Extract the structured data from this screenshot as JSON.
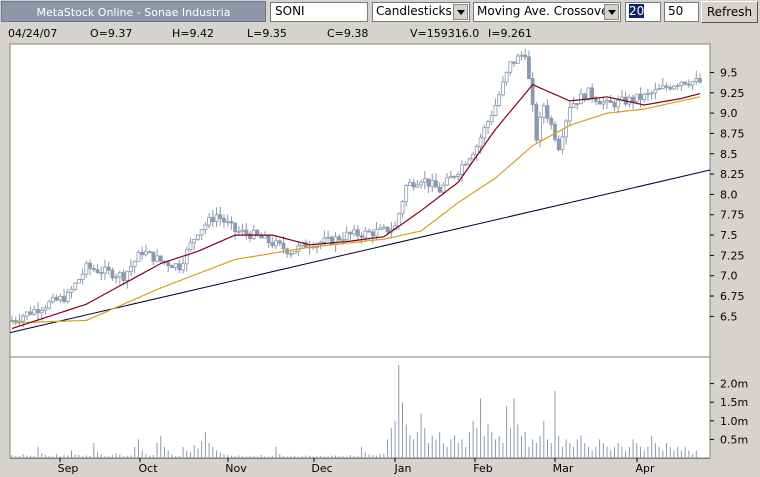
{
  "toolbar": {
    "title": "MetaStock Online - Sonae Industria",
    "symbol": "SONI",
    "chart_type": "Candlesticks",
    "indicator": "Moving Ave. Crossover",
    "period1": "20",
    "period2": "50",
    "refresh_label": "Refresh"
  },
  "quote": {
    "date": "04/24/07",
    "open": "O=9.37",
    "high": "H=9.42",
    "low": "L=9.35",
    "close": "C=9.38",
    "volume": "V=159316.0",
    "indicator": "I=9.261"
  },
  "colors": {
    "background": "#d6d3ce",
    "plot": "#ffffff",
    "candle": "#8a9ab0",
    "ma_short": "#800020",
    "ma_long": "#d4a020",
    "trendline": "#000033"
  },
  "chart_data": {
    "type": "candlestick",
    "price_ticks": [
      "6.5",
      "6.75",
      "7.0",
      "7.25",
      "7.5",
      "7.75",
      "8.0",
      "8.25",
      "8.5",
      "8.75",
      "9.0",
      "9.25",
      "9.5"
    ],
    "volume_ticks": [
      "0.5m",
      "1.0m",
      "1.5m",
      "2.0m"
    ],
    "x_labels": [
      "Sep",
      "Oct",
      "Nov",
      "Dec",
      "Jan",
      "Feb",
      "Mar",
      "Apr"
    ],
    "ylim": [
      6.0,
      9.85
    ],
    "volume_max": 2.5,
    "close_anchors": [
      [
        0,
        6.45
      ],
      [
        8,
        6.62
      ],
      [
        15,
        6.75
      ],
      [
        20,
        7.1
      ],
      [
        25,
        7.05
      ],
      [
        30,
        7.0
      ],
      [
        35,
        7.3
      ],
      [
        40,
        7.18
      ],
      [
        45,
        7.12
      ],
      [
        50,
        7.55
      ],
      [
        55,
        7.75
      ],
      [
        60,
        7.55
      ],
      [
        65,
        7.5
      ],
      [
        70,
        7.4
      ],
      [
        75,
        7.3
      ],
      [
        80,
        7.4
      ],
      [
        85,
        7.42
      ],
      [
        90,
        7.5
      ],
      [
        95,
        7.52
      ],
      [
        100,
        7.55
      ],
      [
        103,
        7.6
      ],
      [
        106,
        8.1
      ],
      [
        110,
        8.2
      ],
      [
        115,
        8.05
      ],
      [
        120,
        8.3
      ],
      [
        125,
        8.6
      ],
      [
        130,
        9.1
      ],
      [
        134,
        9.6
      ],
      [
        138,
        9.75
      ],
      [
        141,
        8.7
      ],
      [
        143,
        9.1
      ],
      [
        147,
        8.6
      ],
      [
        150,
        9.1
      ],
      [
        155,
        9.25
      ],
      [
        160,
        9.1
      ],
      [
        165,
        9.15
      ],
      [
        170,
        9.2
      ],
      [
        175,
        9.3
      ],
      [
        180,
        9.4
      ],
      [
        185,
        9.38
      ]
    ],
    "ma_short": [
      [
        0,
        6.35
      ],
      [
        20,
        6.65
      ],
      [
        30,
        6.9
      ],
      [
        40,
        7.15
      ],
      [
        50,
        7.3
      ],
      [
        60,
        7.5
      ],
      [
        70,
        7.5
      ],
      [
        80,
        7.38
      ],
      [
        90,
        7.42
      ],
      [
        100,
        7.48
      ],
      [
        110,
        7.8
      ],
      [
        120,
        8.15
      ],
      [
        130,
        8.8
      ],
      [
        140,
        9.35
      ],
      [
        150,
        9.15
      ],
      [
        160,
        9.2
      ],
      [
        170,
        9.1
      ],
      [
        180,
        9.18
      ],
      [
        185,
        9.24
      ]
    ],
    "ma_long": [
      [
        0,
        6.42
      ],
      [
        20,
        6.45
      ],
      [
        40,
        6.85
      ],
      [
        60,
        7.2
      ],
      [
        80,
        7.35
      ],
      [
        100,
        7.45
      ],
      [
        110,
        7.55
      ],
      [
        120,
        7.9
      ],
      [
        130,
        8.2
      ],
      [
        140,
        8.6
      ],
      [
        150,
        8.85
      ],
      [
        160,
        9.0
      ],
      [
        170,
        9.05
      ],
      [
        180,
        9.15
      ],
      [
        185,
        9.2
      ]
    ],
    "trendline": [
      [
        6.3
      ],
      [
        8.3
      ]
    ],
    "volume_profile": [
      0.08,
      0.06,
      0.05,
      0.1,
      0.07,
      0.06,
      0.05,
      0.3,
      0.12,
      0.08,
      0.06,
      0.04,
      0.1,
      0.05,
      0.08,
      0.06,
      0.2,
      0.1,
      0.08,
      0.05,
      0.07,
      0.06,
      0.4,
      0.15,
      0.1,
      0.06,
      0.05,
      0.08,
      0.12,
      0.1,
      0.05,
      0.06,
      0.07,
      0.3,
      0.5,
      0.2,
      0.1,
      0.06,
      0.08,
      0.4,
      0.6,
      0.3,
      0.2,
      0.1,
      0.05,
      0.06,
      0.3,
      0.2,
      0.15,
      0.35,
      0.25,
      0.45,
      0.7,
      0.4,
      0.3,
      0.2,
      0.15,
      0.1,
      0.08,
      0.06,
      0.05,
      0.07,
      0.05,
      0.04,
      0.06,
      0.05,
      0.04,
      0.08,
      0.05,
      0.04,
      0.06,
      0.3,
      0.1,
      0.05,
      0.04,
      0.06,
      0.05,
      0.04,
      0.05,
      0.07,
      0.06,
      0.04,
      0.05,
      0.06,
      0.04,
      0.05,
      0.06,
      0.07,
      0.05,
      0.06,
      0.04,
      0.08,
      0.06,
      0.05,
      0.3,
      0.15,
      0.1,
      0.08,
      0.06,
      0.1,
      0.12,
      0.5,
      0.8,
      1.0,
      2.5,
      1.5,
      0.9,
      0.6,
      0.5,
      0.7,
      1.2,
      0.8,
      0.4,
      0.6,
      0.5,
      0.7,
      0.4,
      0.3,
      0.5,
      0.6,
      0.4,
      0.5,
      0.3,
      0.7,
      1.0,
      0.8,
      1.6,
      0.6,
      0.9,
      0.7,
      0.5,
      0.6,
      0.4,
      1.4,
      0.8,
      1.6,
      0.9,
      0.6,
      0.7,
      0.3,
      0.5,
      0.4,
      0.6,
      1.0,
      0.5,
      0.4,
      1.8,
      0.6,
      0.3,
      0.5,
      0.4,
      0.3,
      0.5,
      0.6,
      0.4,
      0.3,
      0.2,
      0.3,
      0.5,
      0.4,
      0.3,
      0.2,
      0.3,
      0.4,
      0.3,
      0.2,
      0.3,
      0.5,
      0.4,
      0.3,
      0.2,
      0.3,
      0.6,
      0.4,
      0.3,
      0.2,
      0.4,
      0.3,
      0.2,
      0.3,
      0.2,
      0.3,
      0.2,
      0.1,
      0.2
    ]
  }
}
